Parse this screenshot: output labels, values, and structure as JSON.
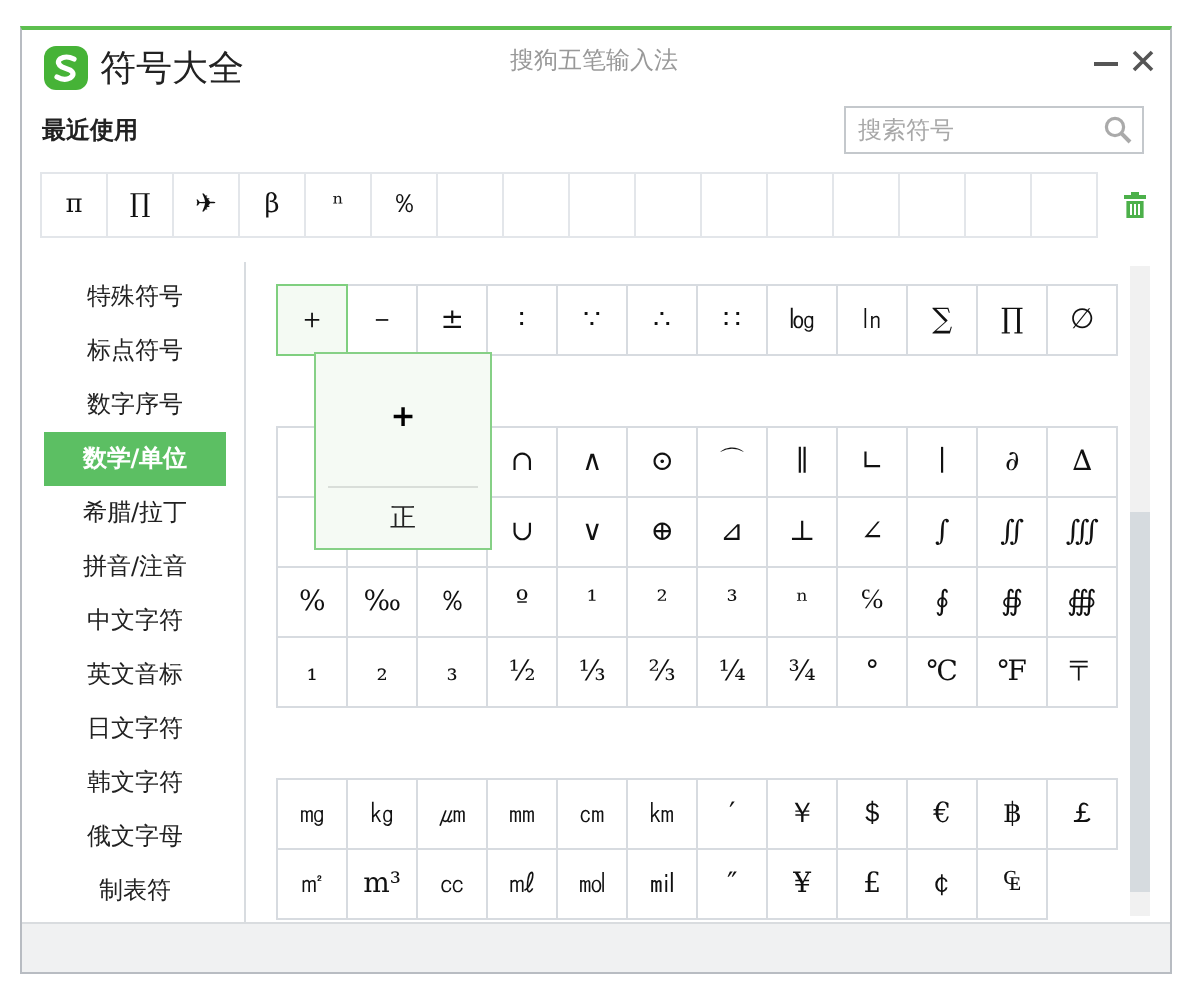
{
  "window": {
    "title": "符号大全",
    "subtitle": "搜狗五笔输入法"
  },
  "recent": {
    "label": "最近使用",
    "symbols": [
      "π",
      "∏",
      "✈",
      "β",
      "ⁿ",
      "％"
    ]
  },
  "search": {
    "placeholder": "搜索符号"
  },
  "sidebar": {
    "items": [
      {
        "label": "特殊符号",
        "selected": false
      },
      {
        "label": "标点符号",
        "selected": false
      },
      {
        "label": "数字序号",
        "selected": false
      },
      {
        "label": "数学/单位",
        "selected": true
      },
      {
        "label": "希腊/拉丁",
        "selected": false
      },
      {
        "label": "拼音/注音",
        "selected": false
      },
      {
        "label": "中文字符",
        "selected": false
      },
      {
        "label": "英文音标",
        "selected": false
      },
      {
        "label": "日文字符",
        "selected": false
      },
      {
        "label": "韩文字符",
        "selected": false
      },
      {
        "label": "俄文字母",
        "selected": false
      },
      {
        "label": "制表符",
        "selected": false
      }
    ]
  },
  "groups": [
    {
      "rows": [
        [
          {
            "symbol": "＋",
            "selected": true
          },
          {
            "symbol": "－",
            "selected": false
          },
          {
            "symbol": "±",
            "selected": false
          },
          {
            "symbol": "∶",
            "selected": false
          },
          {
            "symbol": "∵",
            "selected": false
          },
          {
            "symbol": "∴",
            "selected": false
          },
          {
            "symbol": "∷",
            "selected": false
          },
          {
            "symbol": "㏒",
            "selected": false
          },
          {
            "symbol": "㏑",
            "selected": false
          },
          {
            "symbol": "∑",
            "selected": false
          },
          {
            "symbol": "∏",
            "selected": false
          },
          {
            "symbol": "∅",
            "selected": false
          }
        ]
      ]
    },
    {
      "rows": [
        [
          null,
          null,
          null,
          {
            "symbol": "∩",
            "selected": false
          },
          {
            "symbol": "∧",
            "selected": false
          },
          {
            "symbol": "⊙",
            "selected": false
          },
          {
            "symbol": "⌒",
            "selected": false
          },
          {
            "symbol": "∥",
            "selected": false
          },
          {
            "symbol": "∟",
            "selected": false
          },
          {
            "symbol": "∣",
            "selected": false
          },
          {
            "symbol": "∂",
            "selected": false
          },
          {
            "symbol": "∆",
            "selected": false
          }
        ],
        [
          null,
          null,
          null,
          {
            "symbol": "∪",
            "selected": false
          },
          {
            "symbol": "∨",
            "selected": false
          },
          {
            "symbol": "⊕",
            "selected": false
          },
          {
            "symbol": "⊿",
            "selected": false
          },
          {
            "symbol": "⊥",
            "selected": false
          },
          {
            "symbol": "∠",
            "selected": false
          },
          {
            "symbol": "∫",
            "selected": false
          },
          {
            "symbol": "∬",
            "selected": false
          },
          {
            "symbol": "∭",
            "selected": false
          }
        ],
        [
          {
            "symbol": "%",
            "selected": false
          },
          {
            "symbol": "‰",
            "selected": false
          },
          {
            "symbol": "％",
            "selected": false
          },
          {
            "symbol": "º",
            "selected": false
          },
          {
            "symbol": "¹",
            "selected": false
          },
          {
            "symbol": "²",
            "selected": false
          },
          {
            "symbol": "³",
            "selected": false
          },
          {
            "symbol": "ⁿ",
            "selected": false
          },
          {
            "symbol": "℅",
            "selected": false
          },
          {
            "symbol": "∮",
            "selected": false
          },
          {
            "symbol": "∯",
            "selected": false
          },
          {
            "symbol": "∰",
            "selected": false
          }
        ],
        [
          {
            "symbol": "₁",
            "selected": false
          },
          {
            "symbol": "₂",
            "selected": false
          },
          {
            "symbol": "₃",
            "selected": false
          },
          {
            "symbol": "½",
            "selected": false
          },
          {
            "symbol": "⅓",
            "selected": false
          },
          {
            "symbol": "⅔",
            "selected": false
          },
          {
            "symbol": "¼",
            "selected": false
          },
          {
            "symbol": "¾",
            "selected": false
          },
          {
            "symbol": "°",
            "selected": false
          },
          {
            "symbol": "℃",
            "selected": false
          },
          {
            "symbol": "℉",
            "selected": false
          },
          {
            "symbol": "〒",
            "selected": false
          }
        ]
      ]
    },
    {
      "rows": [
        [
          {
            "symbol": "㎎",
            "selected": false
          },
          {
            "symbol": "㎏",
            "selected": false
          },
          {
            "symbol": "㎛",
            "selected": false
          },
          {
            "symbol": "㎜",
            "selected": false
          },
          {
            "symbol": "㎝",
            "selected": false
          },
          {
            "symbol": "㎞",
            "selected": false
          },
          {
            "symbol": "′",
            "selected": false
          },
          {
            "symbol": "￥",
            "selected": false
          },
          {
            "symbol": "＄",
            "selected": false
          },
          {
            "symbol": "€",
            "selected": false
          },
          {
            "symbol": "฿",
            "selected": false
          },
          {
            "symbol": "￡",
            "selected": false
          }
        ],
        [
          {
            "symbol": "㎡",
            "selected": false
          },
          {
            "symbol": "m³",
            "selected": false
          },
          {
            "symbol": "㏄",
            "selected": false
          },
          {
            "symbol": "㎖",
            "selected": false
          },
          {
            "symbol": "㏖",
            "selected": false
          },
          {
            "symbol": "㏕",
            "selected": false
          },
          {
            "symbol": "″",
            "selected": false
          },
          {
            "symbol": "¥",
            "selected": false
          },
          {
            "symbol": "£",
            "selected": false
          },
          {
            "symbol": "￠",
            "selected": false
          },
          {
            "symbol": "₠",
            "selected": false
          }
        ]
      ]
    }
  ],
  "popup": {
    "symbol": "+",
    "reading": "正"
  }
}
